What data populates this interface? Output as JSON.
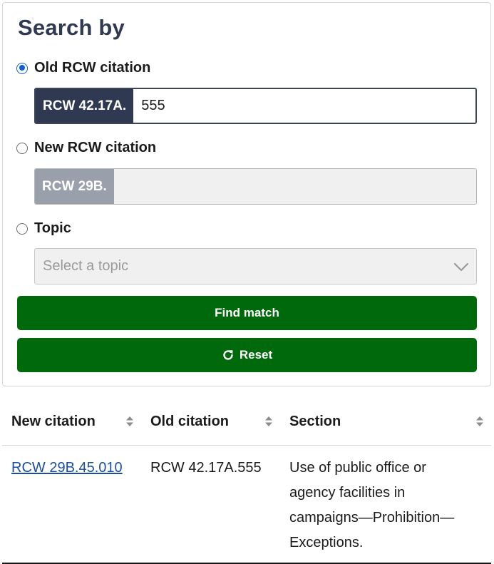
{
  "search": {
    "title": "Search by",
    "options": [
      {
        "label": "Old RCW citation",
        "checked": true,
        "prefix": "RCW 42.17A.",
        "value": "555"
      },
      {
        "label": "New RCW citation",
        "checked": false,
        "prefix": "RCW 29B.",
        "value": ""
      },
      {
        "label": "Topic",
        "checked": false
      }
    ],
    "topic_placeholder": "Select a topic",
    "find_button": "Find match",
    "reset_button": "Reset"
  },
  "table": {
    "headers": [
      "New citation",
      "Old citation",
      "Section"
    ],
    "rows": [
      {
        "new_citation": "RCW 29B.45.010",
        "old_citation": "RCW 42.17A.555",
        "section": "Use of public office or agency facilities in campaigns—Prohibition—Exceptions."
      }
    ]
  },
  "colors": {
    "primary_button": "#00690b",
    "prefix_active": "#2f3a52",
    "prefix_disabled": "#9aa0ab",
    "radio_checked": "#0b5fd9",
    "link": "#1a4f9c"
  },
  "icons": [
    "chevron-down-icon",
    "reload-icon",
    "sort-icon"
  ]
}
